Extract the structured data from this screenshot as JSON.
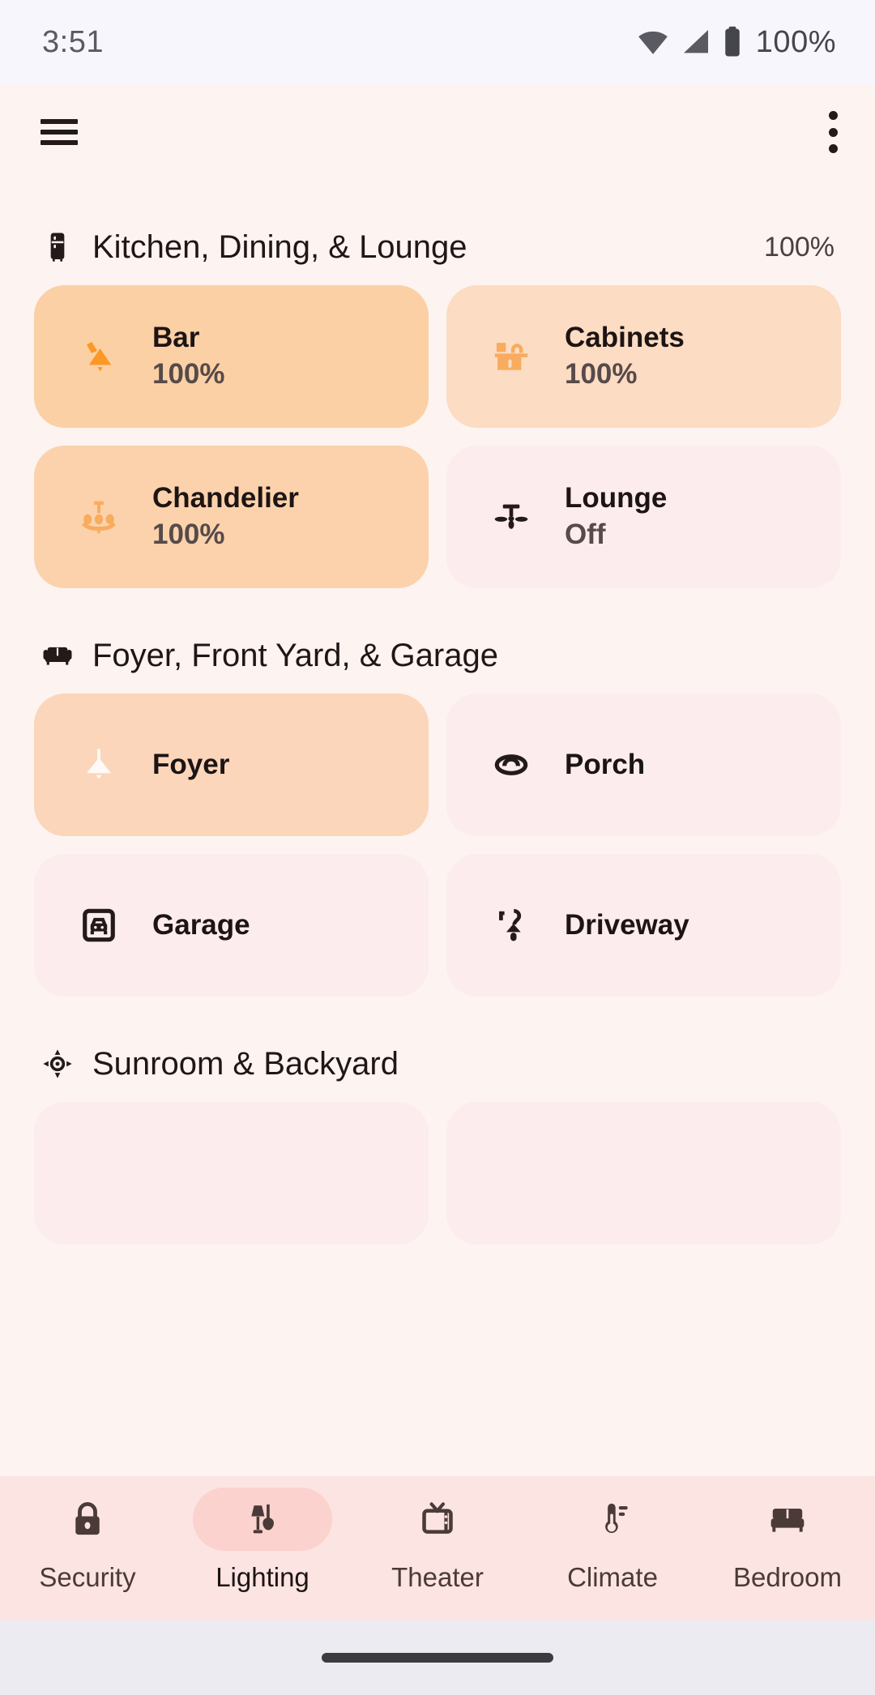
{
  "status_bar": {
    "time": "3:51",
    "battery_percent": "100%",
    "icons": [
      "wifi-icon",
      "cellular-signal-icon",
      "battery-icon"
    ]
  },
  "app_bar": {
    "menu_icon": "hamburger-menu-icon",
    "overflow_icon": "overflow-menu-icon"
  },
  "colors": {
    "page_background": "#fdf3f1",
    "status_bar_background": "#f7f6fd",
    "card_on_strong": "#fbd0a4",
    "card_on_medium": "#fcdcc2",
    "card_off": "#fdeced",
    "icon_on_strong": "#fd9725",
    "icon_on_medium": "#f9ab5e",
    "icon_off": "#241a1a",
    "nav_background": "#fbe4e2",
    "nav_active_pill": "#fbd2cd"
  },
  "sections": [
    {
      "title": "Kitchen, Dining, & Lounge",
      "icon": "refrigerator-icon",
      "percent": "100%",
      "cards": [
        {
          "name": "Bar",
          "state": "100%",
          "icon": "wall-sconce-icon",
          "style": "on-strong"
        },
        {
          "name": "Cabinets",
          "state": "100%",
          "icon": "cabinet-icon",
          "style": "on-medium"
        },
        {
          "name": "Chandelier",
          "state": "100%",
          "icon": "chandelier-icon",
          "style": "on-medium"
        },
        {
          "name": "Lounge",
          "state": "Off",
          "icon": "ceiling-fan-icon",
          "style": "off"
        }
      ]
    },
    {
      "title": "Foyer, Front Yard, & Garage",
      "icon": "sofa-icon",
      "percent": "",
      "cards": [
        {
          "name": "Foyer",
          "state": "",
          "icon": "pendant-light-icon",
          "style": "on-medium-white-icon"
        },
        {
          "name": "Porch",
          "state": "",
          "icon": "dome-light-icon",
          "style": "off"
        },
        {
          "name": "Garage",
          "state": "",
          "icon": "garage-car-icon",
          "style": "off"
        },
        {
          "name": "Driveway",
          "state": "",
          "icon": "path-light-icon",
          "style": "off"
        }
      ]
    },
    {
      "title": "Sunroom & Backyard",
      "icon": "sun-brightness-icon",
      "percent": "",
      "cards": [
        {
          "name": "",
          "state": "",
          "icon": "",
          "style": "off"
        },
        {
          "name": "",
          "state": "",
          "icon": "",
          "style": "off"
        }
      ]
    }
  ],
  "bottom_nav": {
    "items": [
      {
        "label": "Security",
        "icon": "lock-icon",
        "active": false
      },
      {
        "label": "Lighting",
        "icon": "lamp-icon",
        "active": true
      },
      {
        "label": "Theater",
        "icon": "television-icon",
        "active": false
      },
      {
        "label": "Climate",
        "icon": "thermometer-icon",
        "active": false
      },
      {
        "label": "Bedroom",
        "icon": "bed-icon",
        "active": false
      }
    ]
  }
}
